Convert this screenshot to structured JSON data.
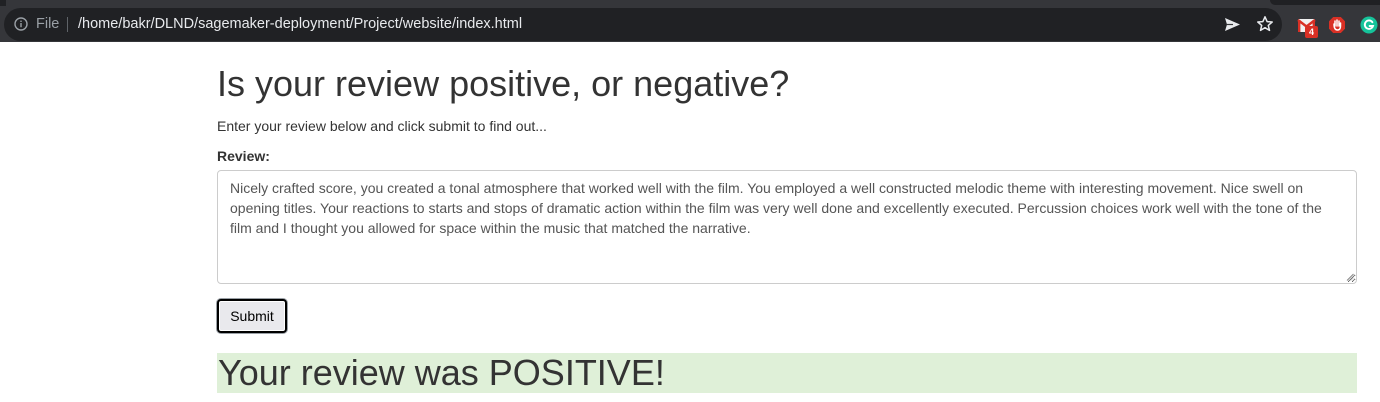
{
  "browser": {
    "scheme_label": "File",
    "url": "/home/bakr/DLND/sagemaker-deployment/Project/website/index.html",
    "extensions": {
      "mail_badge": "4"
    },
    "icons": [
      "info-icon",
      "send-icon",
      "star-icon",
      "gmail-extension-icon",
      "stop-hand-extension-icon",
      "grammarly-extension-icon"
    ]
  },
  "page": {
    "title": "Is your review positive, or negative?",
    "subtitle": "Enter your review below and click submit to find out...",
    "review_label": "Review:",
    "review_text": "Nicely crafted score, you created a tonal atmosphere that worked well with the film. You employed a well constructed melodic theme with interesting movement. Nice swell on opening titles. Your reactions to starts and stops of dramatic action within the film was very well done and excellently executed. Percussion choices work well with the tone of the film and I thought you allowed for space within the music that matched the narrative.",
    "submit_label": "Submit",
    "result_text": "Your review was POSITIVE!"
  },
  "colors": {
    "toolbar_bg": "#35363a",
    "omnibox_bg": "#202124",
    "result_bg": "#dff0d8",
    "text": "#333333"
  }
}
